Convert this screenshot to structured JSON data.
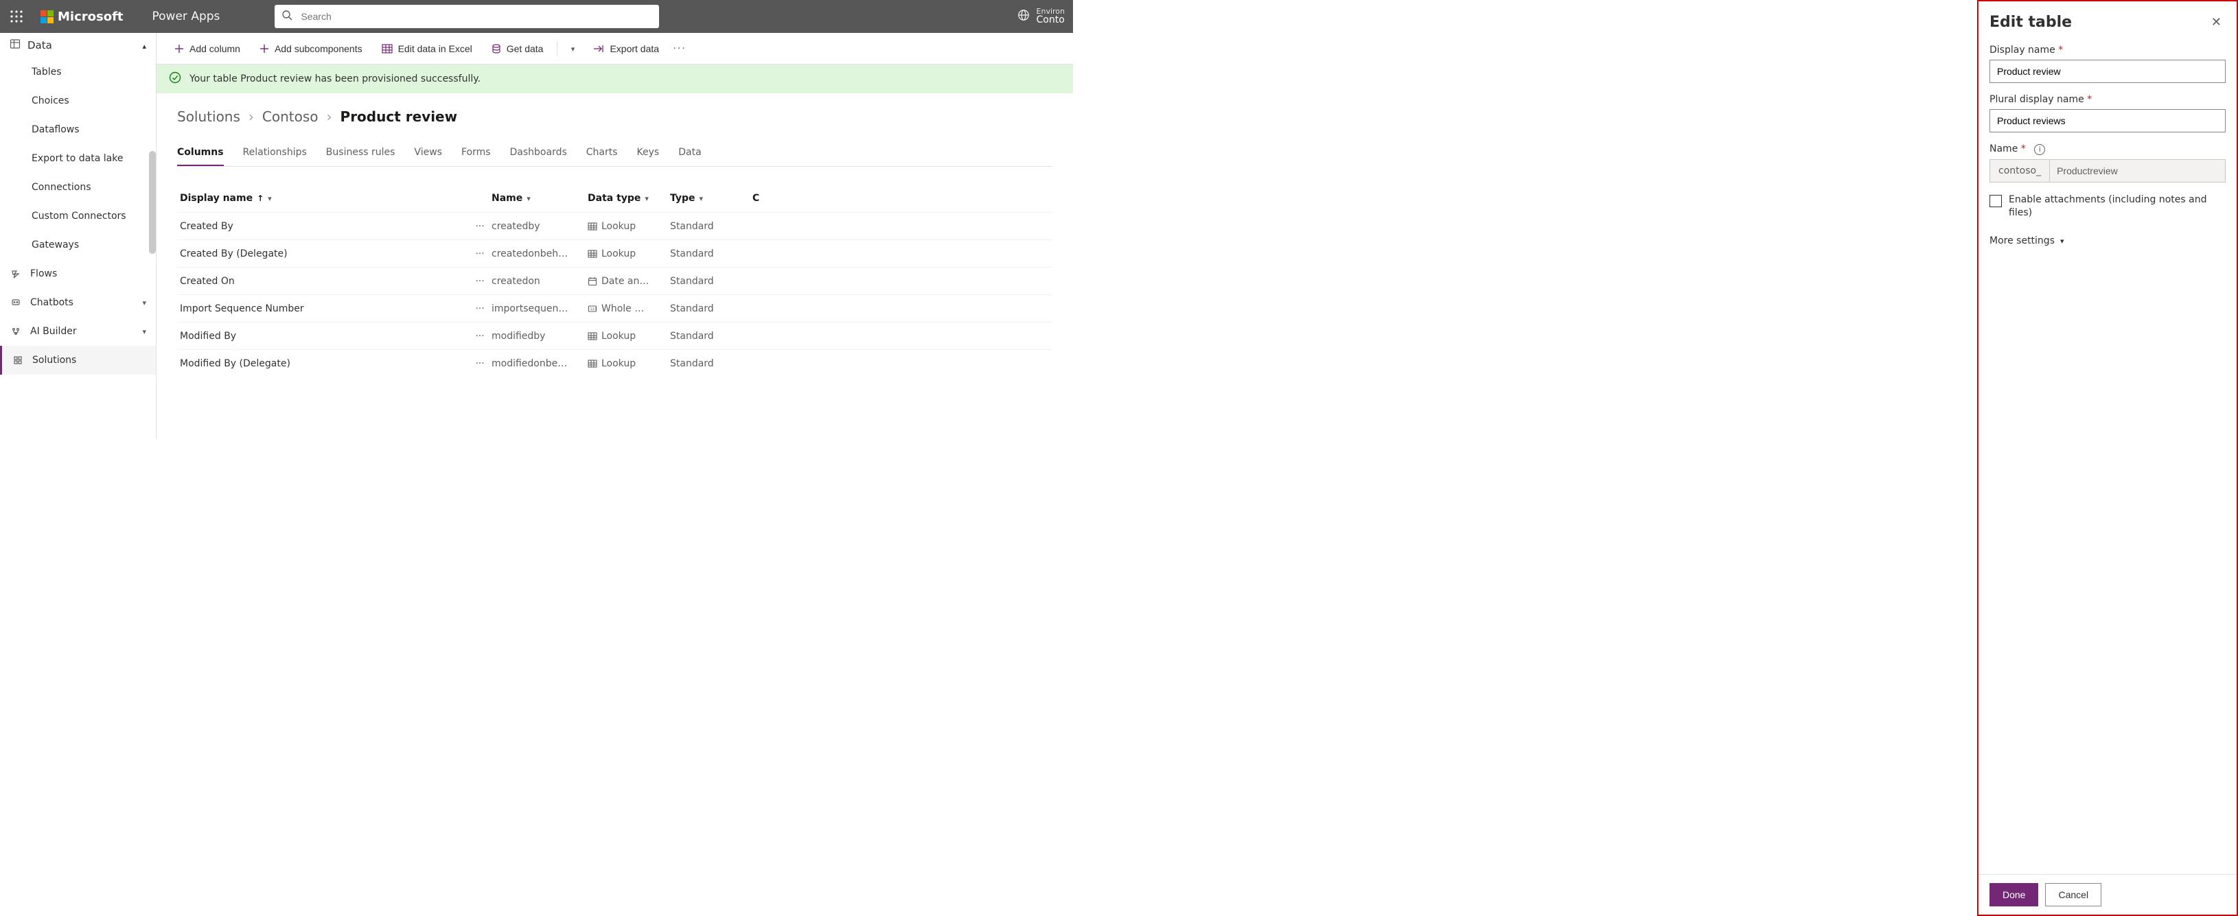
{
  "header": {
    "brand": "Microsoft",
    "app": "Power Apps",
    "search_placeholder": "Search",
    "env_label": "Environ",
    "env_name": "Conto"
  },
  "sidebar": {
    "group": "Data",
    "items": [
      {
        "label": "Tables"
      },
      {
        "label": "Choices"
      },
      {
        "label": "Dataflows"
      },
      {
        "label": "Export to data lake"
      },
      {
        "label": "Connections"
      },
      {
        "label": "Custom Connectors"
      },
      {
        "label": "Gateways"
      }
    ],
    "top_items": [
      {
        "label": "Flows",
        "exp": false
      },
      {
        "label": "Chatbots",
        "exp": true
      },
      {
        "label": "AI Builder",
        "exp": true
      },
      {
        "label": "Solutions",
        "selected": true
      }
    ]
  },
  "commands": {
    "add_column": "Add column",
    "add_subcomponents": "Add subcomponents",
    "edit_excel": "Edit data in Excel",
    "get_data": "Get data",
    "export_data": "Export data"
  },
  "banner": {
    "text": "Your table Product review has been provisioned successfully."
  },
  "breadcrumb": {
    "solutions": "Solutions",
    "env": "Contoso",
    "current": "Product review"
  },
  "tabs": [
    {
      "label": "Columns",
      "active": true
    },
    {
      "label": "Relationships"
    },
    {
      "label": "Business rules"
    },
    {
      "label": "Views"
    },
    {
      "label": "Forms"
    },
    {
      "label": "Dashboards"
    },
    {
      "label": "Charts"
    },
    {
      "label": "Keys"
    },
    {
      "label": "Data"
    }
  ],
  "grid": {
    "headers": {
      "display": "Display name",
      "name": "Name",
      "data_type": "Data type",
      "type": "Type",
      "extra": "C"
    },
    "rows": [
      {
        "display": "Created By",
        "name": "createdby",
        "data_type": "Lookup",
        "kind": "Standard",
        "icon": "table"
      },
      {
        "display": "Created By (Delegate)",
        "name": "createdonbeh…",
        "data_type": "Lookup",
        "kind": "Standard",
        "icon": "table"
      },
      {
        "display": "Created On",
        "name": "createdon",
        "data_type": "Date an…",
        "kind": "Standard",
        "icon": "calendar"
      },
      {
        "display": "Import Sequence Number",
        "name": "importsequen…",
        "data_type": "Whole …",
        "kind": "Standard",
        "icon": "number"
      },
      {
        "display": "Modified By",
        "name": "modifiedby",
        "data_type": "Lookup",
        "kind": "Standard",
        "icon": "table"
      },
      {
        "display": "Modified By (Delegate)",
        "name": "modifiedonbe…",
        "data_type": "Lookup",
        "kind": "Standard",
        "icon": "table"
      }
    ]
  },
  "panel": {
    "title": "Edit table",
    "display_label": "Display name",
    "display_value": "Product review",
    "plural_label": "Plural display name",
    "plural_value": "Product reviews",
    "name_label": "Name",
    "name_prefix": "contoso_",
    "name_value": "Productreview",
    "attach_label": "Enable attachments (including notes and files)",
    "more_settings": "More settings",
    "done": "Done",
    "cancel": "Cancel"
  }
}
